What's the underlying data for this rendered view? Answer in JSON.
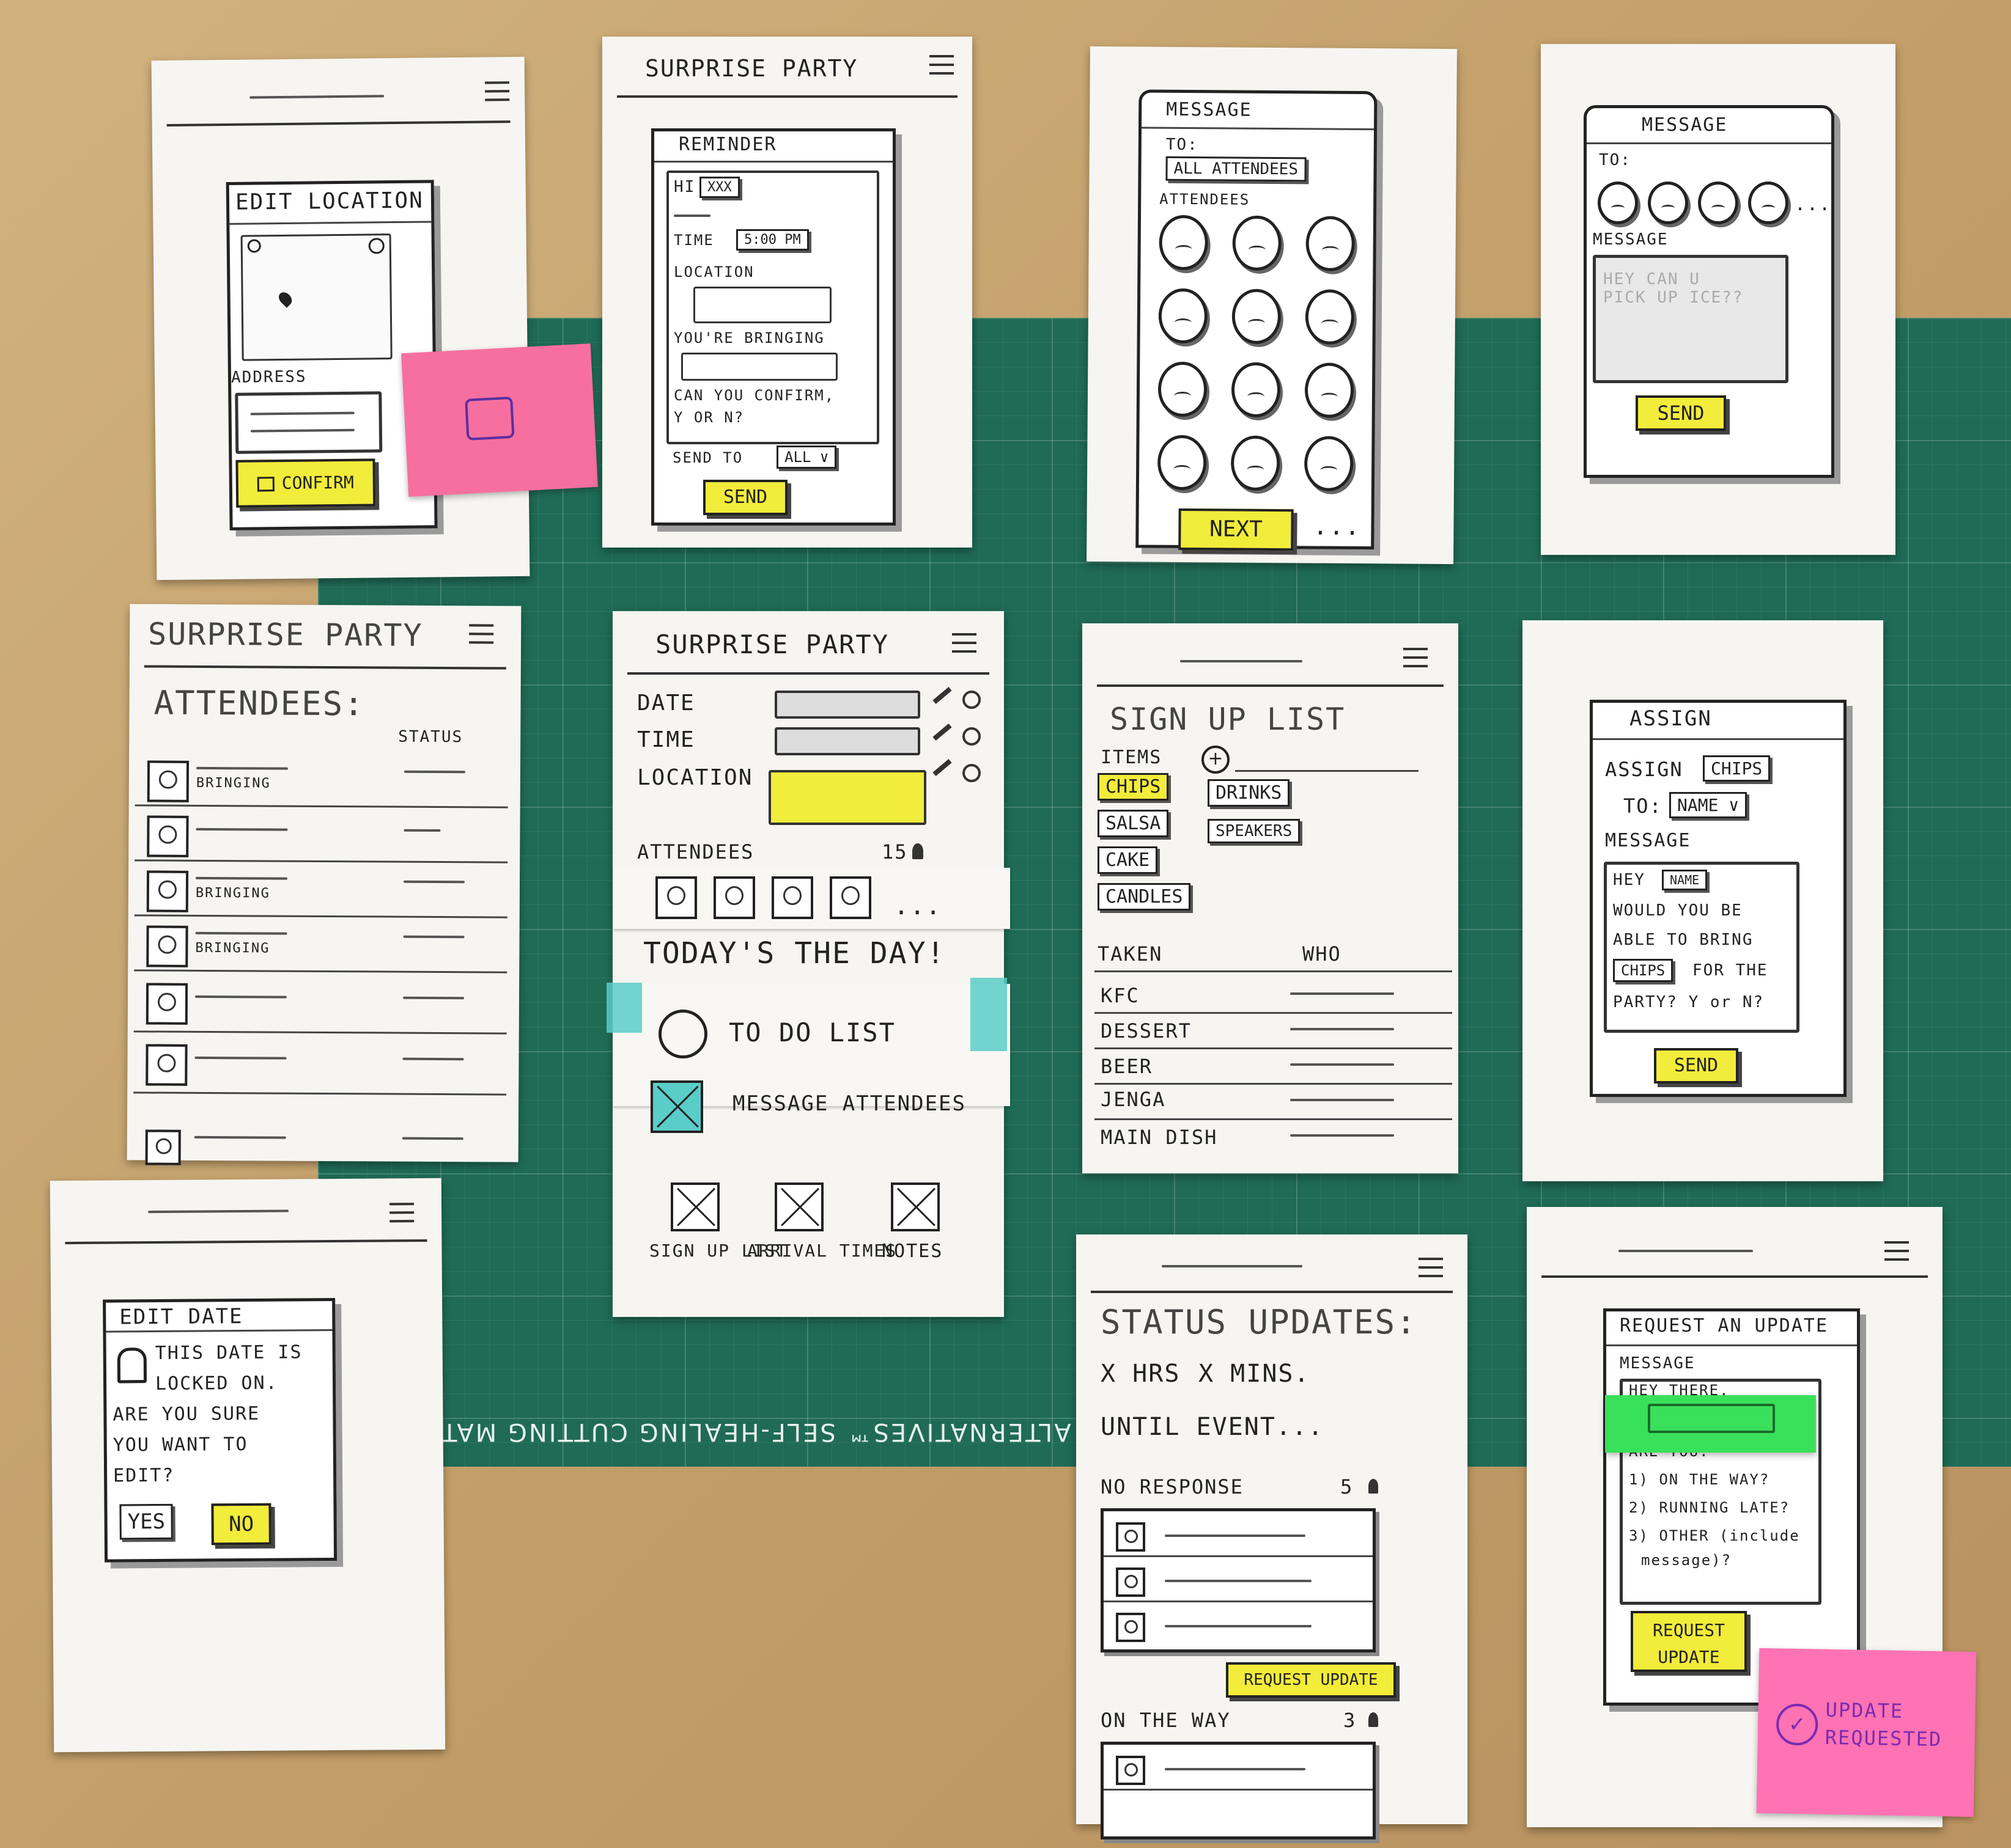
{
  "mat": {
    "brand": "ART ALTERNATIVES™  SELF-HEALING CUTTING MAT"
  },
  "screens": {
    "edit_location": {
      "title": "EDIT LOCATION",
      "address_label": "ADDRESS",
      "confirm_label": "CONFIRM"
    },
    "reminder": {
      "app_title": "SURPRISE PARTY",
      "title": "REMINDER",
      "greeting": "HI",
      "name_field": "XXX",
      "time_label": "TIME",
      "time_value": "5:00 PM",
      "location_label": "LOCATION",
      "bringing_label": "YOU'RE BRINGING",
      "confirm_text": "CAN YOU CONFIRM,",
      "confirm_options": "Y OR N?",
      "send_to_label": "SEND TO",
      "send_to_value": "ALL",
      "send_label": "SEND"
    },
    "message_select": {
      "title": "MESSAGE",
      "to_label": "TO:",
      "to_value": "ALL ATTENDEES",
      "attendees_label": "ATTENDEES",
      "next_label": "NEXT",
      "more": "..."
    },
    "message_compose": {
      "title": "MESSAGE",
      "to_label": "TO:",
      "message_label": "MESSAGE",
      "message_value": "HEY CAN U PICK UP ICE??",
      "more": "...",
      "send_label": "SEND"
    },
    "attendees": {
      "app_title": "SURPRISE PARTY",
      "title": "ATTENDEES:",
      "status_label": "STATUS",
      "bringing": "BRINGING"
    },
    "dashboard": {
      "app_title": "SURPRISE PARTY",
      "date_label": "DATE",
      "time_label": "TIME",
      "location_label": "LOCATION",
      "attendees_label": "ATTENDEES",
      "attendees_count": "15",
      "more": "...",
      "today_label": "TODAY'S THE DAY!",
      "todo_label": "TO DO LIST",
      "message_label": "MESSAGE ATTENDEES",
      "signup_label": "SIGN UP LIST",
      "arrival_label": "ARRIVAL TIMES",
      "notes_label": "NOTES"
    },
    "signup": {
      "title": "SIGN UP LIST",
      "items_label": "ITEMS",
      "items": [
        "CHIPS",
        "DRINKS",
        "SALSA",
        "SPEAKERS",
        "CAKE",
        "CANDLES"
      ],
      "taken_label": "TAKEN",
      "who_label": "WHO",
      "taken": [
        "KFC",
        "DESSERT",
        "BEER",
        "JENGA",
        "MAIN DISH"
      ]
    },
    "assign": {
      "title": "ASSIGN",
      "assign_label": "ASSIGN",
      "assign_value": "CHIPS",
      "to_label": "TO:",
      "to_value": "NAME",
      "message_label": "MESSAGE",
      "msg_hey": "HEY",
      "msg_name": "NAME",
      "msg_line1": "WOULD YOU BE",
      "msg_line2": "ABLE TO BRING",
      "msg_chips": "CHIPS",
      "msg_line3": "FOR THE",
      "msg_line4": "PARTY? Y or N?",
      "send_label": "SEND"
    },
    "edit_date": {
      "title": "EDIT DATE",
      "line1": "THIS DATE IS",
      "line2": "LOCKED ON.",
      "line3": "ARE YOU SURE",
      "line4": "YOU WANT TO",
      "line5": "EDIT?",
      "yes_label": "YES",
      "no_label": "NO"
    },
    "status": {
      "title": "STATUS UPDATES:",
      "countdown_hrs": "X HRS",
      "countdown_mins": "X MINS.",
      "until": "UNTIL EVENT...",
      "no_response_label": "NO RESPONSE",
      "no_response_count": "5",
      "request_label": "REQUEST UPDATE",
      "on_the_way_label": "ON THE WAY",
      "on_the_way_count": "3"
    },
    "request": {
      "title": "REQUEST AN UPDATE",
      "message_label": "MESSAGE",
      "msg_line1": "HEY THERE,",
      "msg_line2": "ARE YOU:",
      "opt1": "1) ON THE WAY?",
      "opt2": "2) RUNNING LATE?",
      "opt3": "3) OTHER (include",
      "opt3b": "message)?",
      "request_label": "REQUEST",
      "request_label2": "UPDATE"
    }
  },
  "sticky_update": {
    "line1": "UPDATE",
    "line2": "REQUESTED"
  },
  "colors": {
    "highlight": "#f2ec3a",
    "pink_sticky": "#f76f9f",
    "green_sticky": "#39e05a",
    "mat": "#1f6b55",
    "tape": "#5acdc8"
  }
}
